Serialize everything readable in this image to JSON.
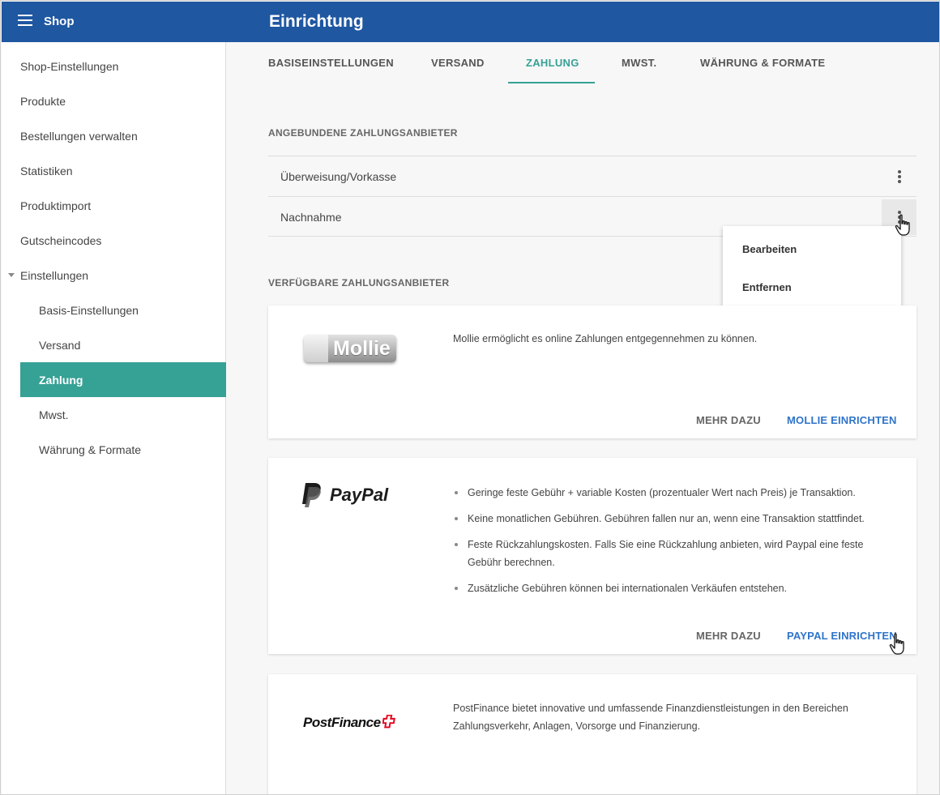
{
  "header": {
    "shop_title": "Shop",
    "page_title": "Einrichtung"
  },
  "sidebar": {
    "items": [
      {
        "label": "Shop-Einstellungen"
      },
      {
        "label": "Produkte"
      },
      {
        "label": "Bestellungen verwalten"
      },
      {
        "label": "Statistiken"
      },
      {
        "label": "Produktimport"
      },
      {
        "label": "Gutscheincodes"
      },
      {
        "label": "Einstellungen"
      }
    ],
    "sub_items": [
      {
        "label": "Basis-Einstellungen"
      },
      {
        "label": "Versand"
      },
      {
        "label": "Zahlung"
      },
      {
        "label": "Mwst."
      },
      {
        "label": "Währung & Formate"
      }
    ]
  },
  "tabs": [
    {
      "label": "BASISEINSTELLUNGEN"
    },
    {
      "label": "VERSAND"
    },
    {
      "label": "ZAHLUNG"
    },
    {
      "label": "MWST."
    },
    {
      "label": "WÄHRUNG & FORMATE"
    }
  ],
  "active_tab": "ZAHLUNG",
  "connected": {
    "heading": "ANGEBUNDENE ZAHLUNGSANBIETER",
    "rows": [
      {
        "name": "Überweisung/Vorkasse"
      },
      {
        "name": "Nachnahme"
      }
    ]
  },
  "row_menu": {
    "items": [
      {
        "label": "Bearbeiten"
      },
      {
        "label": "Entfernen"
      }
    ]
  },
  "available": {
    "heading": "VERFÜGBARE ZAHLUNGSANBIETER",
    "providers": [
      {
        "logo_text": "Mollie",
        "description": "Mollie ermöglicht es online Zahlungen entgegennehmen zu können.",
        "more_label": "MEHR DAZU",
        "setup_label": "MOLLIE EINRICHTEN"
      },
      {
        "logo_text": "PayPal",
        "bullets": [
          "Geringe feste Gebühr + variable Kosten (prozentualer Wert nach Preis) je Transaktion.",
          "Keine monatlichen Gebühren. Gebühren fallen nur an, wenn eine Transaktion stattfindet.",
          "Feste Rückzahlungskosten. Falls Sie eine Rückzahlung anbieten, wird Paypal eine feste Gebühr berechnen.",
          "Zusätzliche Gebühren können bei internationalen Verkäufen entstehen."
        ],
        "more_label": "MEHR DAZU",
        "setup_label": "PAYPAL EINRICHTEN"
      },
      {
        "logo_text": "PostFinance",
        "description": "PostFinance bietet innovative und umfassende Finanzdienstleistungen in den Bereichen Zahlungsverkehr, Anlagen, Vorsorge und Finanzierung."
      }
    ]
  },
  "colors": {
    "header": "#1f57a1",
    "accent": "#36a195",
    "link": "#2f74c9",
    "postfinance_red": "#e3001b"
  },
  "icons": [
    "menu-icon",
    "caret-down-icon",
    "more-vert-icon",
    "hand-pointer-icon",
    "paypal-p-icon",
    "swiss-cross-icon"
  ]
}
